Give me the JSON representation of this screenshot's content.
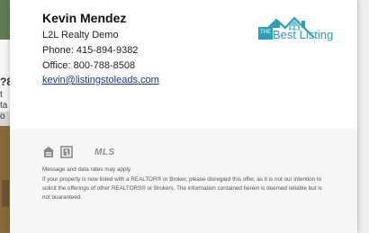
{
  "background": {
    "left_fragments": [
      "?8",
      "t",
      "ta",
      "o"
    ]
  },
  "agent": {
    "name": "Kevin Mendez",
    "company": "L2L Realty Demo",
    "phone": "Phone: 415-894-9382",
    "office": "Office: 800-788-8508",
    "email": "kevin@listingstoleads.com"
  },
  "logo": {
    "prefix": "THE",
    "text": "Best Listing",
    "color": "#2aa0b8"
  },
  "badges": {
    "icons": [
      "equal-housing-icon",
      "realtor-icon"
    ],
    "mls_text": "MLS"
  },
  "disclaimer": {
    "line1": "Message and data rates may apply.",
    "body": "If your property is now listed with a REALTOR® or Broker, please disregard this offer, as it is not our intention to solicit the offerings of other REALTORS® or Brokers. The information contained herein is deemed reliable but is not guaranteed."
  }
}
